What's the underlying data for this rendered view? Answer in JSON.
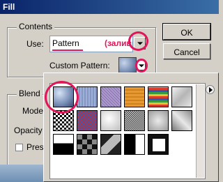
{
  "window": {
    "title": "Fill"
  },
  "contents": {
    "group_label": "Contents",
    "use_label": "Use:",
    "use_value": "Pattern",
    "use_note": "(заливка)",
    "custom_pattern_label": "Custom Pattern:"
  },
  "blending": {
    "group_label": "Blend",
    "mode_label": "Mode",
    "opacity_label": "Opacity",
    "preserve_label": "Pres"
  },
  "buttons": {
    "ok": "OK",
    "cancel": "Cancel"
  },
  "colors": {
    "highlight_ring": "#e0155a",
    "titlebar": "#0a246a"
  },
  "pattern_picker": {
    "patterns": [
      "bubbles-blue",
      "blue-weave",
      "purple-fibers",
      "orange-wood",
      "tie-dye-rainbow",
      "grey-wrinkled-paper",
      "checker-bw-small",
      "rainbow-confetti",
      "white-lumps",
      "grey-noise",
      "grey-stucco",
      "grey-marble",
      "black-white-split",
      "black-grey-tiles",
      "dark-diagonal-blocks",
      "black-step-block",
      "white-black-frame"
    ],
    "selected_index": 0
  }
}
